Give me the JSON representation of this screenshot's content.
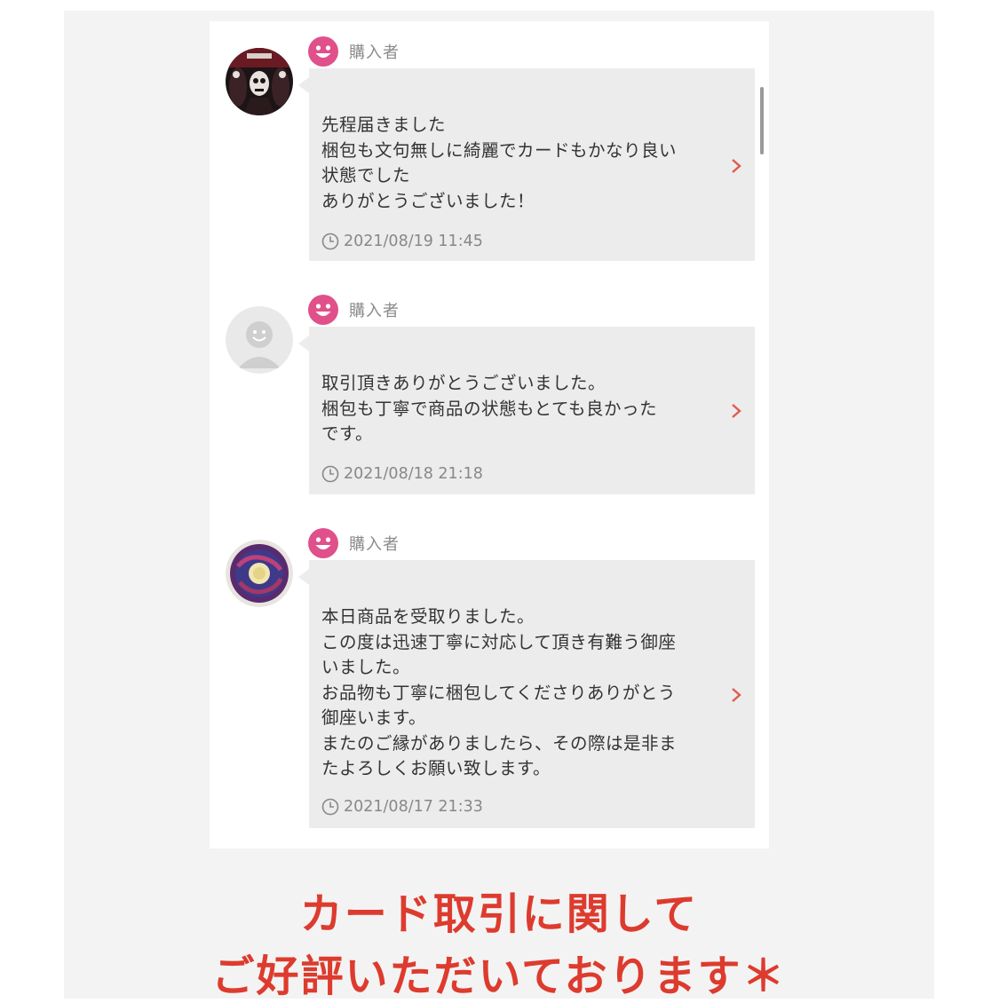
{
  "reviews": [
    {
      "role": "購入者",
      "message": "先程届きました\n梱包も文句無しに綺麗でカードもかなり良い\n状態でした\nありがとうございました！",
      "timestamp": "2021/08/19 11:45",
      "avatar": "dark-skeleton-avatar"
    },
    {
      "role": "購入者",
      "message": "取引頂きありがとうございました。\n梱包も丁寧で商品の状態もとても良かった\nです。",
      "timestamp": "2021/08/18 21:18",
      "avatar": "default-user-avatar"
    },
    {
      "role": "購入者",
      "message": "本日商品を受取りました。\nこの度は迅速丁寧に対応して頂き有難う御座\nいました。\nお品物も丁寧に梱包してくださりありがとう\n御座います。\nまたのご縁がありましたら、その際は是非ま\nたよろしくお願い致します。",
      "timestamp": "2021/08/17 21:33",
      "avatar": "donut-avatar"
    }
  ],
  "caption": {
    "line1": "カード取引に関して",
    "line2": "ご好評いただいております＊"
  },
  "colors": {
    "accent_pink": "#e0508a",
    "chevron_red": "#e05a50",
    "caption_red": "#dd3b2e",
    "bubble_gray": "#ececec"
  }
}
